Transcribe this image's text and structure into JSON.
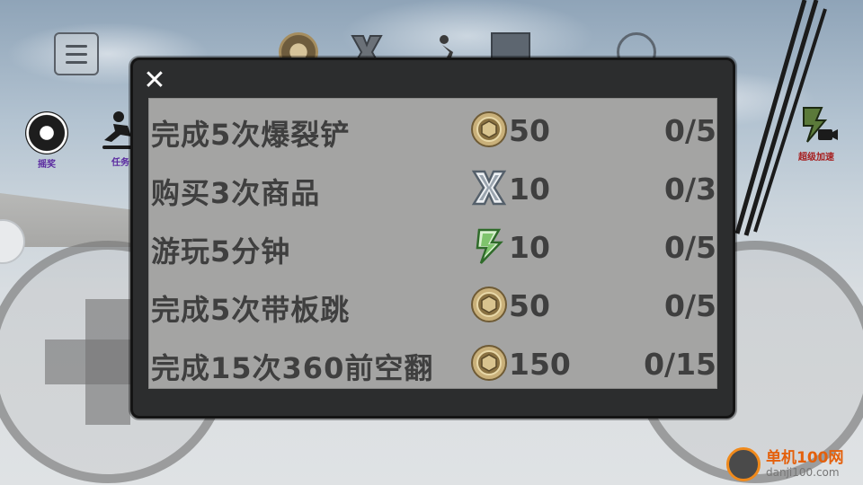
{
  "hud": {
    "lottery_label": "摇奖",
    "task_label": "任务",
    "boost_label": "超级加速"
  },
  "modal": {
    "close_glyph": "✕",
    "tasks": [
      {
        "name": "完成5次爆裂铲",
        "reward_icon": "gold-coin-icon",
        "reward": "50",
        "progress": "0/5"
      },
      {
        "name": "购买3次商品",
        "reward_icon": "x-token-icon",
        "reward": "10",
        "progress": "0/3"
      },
      {
        "name": "游玩5分钟",
        "reward_icon": "lightning-icon",
        "reward": "10",
        "progress": "0/5"
      },
      {
        "name": "完成5次带板跳",
        "reward_icon": "gold-coin-icon",
        "reward": "50",
        "progress": "0/5"
      },
      {
        "name": "完成15次360前空翻",
        "reward_icon": "gold-coin-icon",
        "reward": "150",
        "progress": "0/15"
      }
    ]
  },
  "watermark": {
    "site_name": "单机100网",
    "site_url": "danji100.com"
  },
  "colors": {
    "panel_bg": "#a4a4a3",
    "modal_frame": "#2c2d2e",
    "task_text": "#3f3f3f",
    "coin_gold": "#c9b07a",
    "watermark_orange": "#e4600c"
  }
}
